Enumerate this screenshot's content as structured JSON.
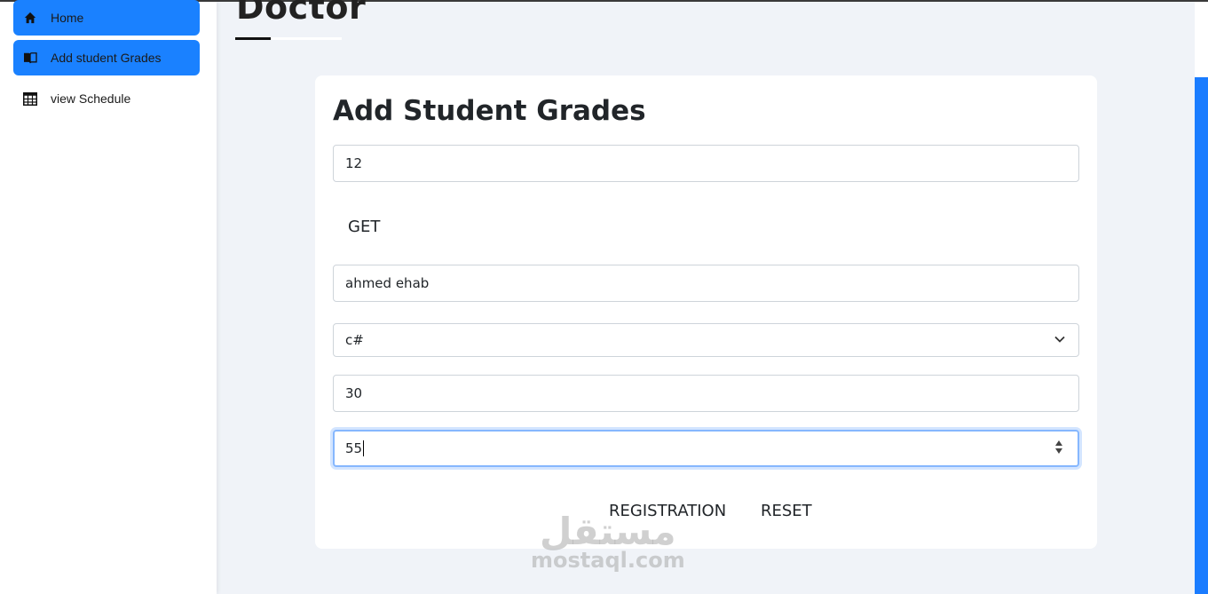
{
  "header": {
    "title": "Doctor"
  },
  "sidebar": {
    "items": [
      {
        "label": "Home",
        "icon": "home-icon",
        "active": true
      },
      {
        "label": "Add student Grades",
        "icon": "book-icon",
        "active": true
      },
      {
        "label": "view Schedule",
        "icon": "table-icon",
        "active": false
      }
    ]
  },
  "form": {
    "title": "Add Student Grades",
    "id_value": "12",
    "get_label": "GET",
    "name_value": "ahmed ehab",
    "course_value": "c#",
    "grade_a_value": "30",
    "grade_b_value": "55",
    "register_label": "REGISTRATION",
    "reset_label": "RESET"
  },
  "watermark": {
    "arabic": "مستقل",
    "latin": "mostaql.com"
  },
  "colors": {
    "accent": "#1a81ff",
    "focus_border": "#86b7fe",
    "background": "#f0f3f8"
  }
}
